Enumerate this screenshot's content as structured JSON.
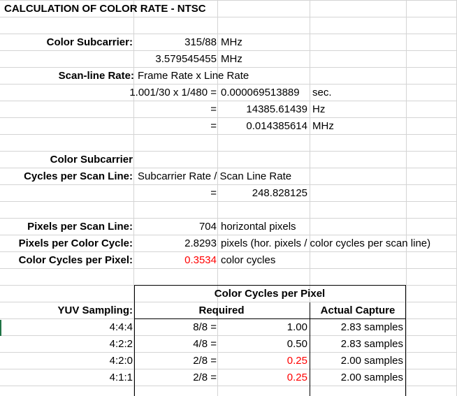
{
  "title": "CALCULATION OF COLOR RATE - NTSC",
  "color_subcarrier": {
    "label": "Color Subcarrier:",
    "fraction": "315/88",
    "fraction_unit": "MHz",
    "decimal": "3.579545455",
    "decimal_unit": "MHz"
  },
  "scan_line_rate": {
    "label": "Scan-line Rate:",
    "formula": "Frame Rate x Line Rate",
    "expr": "1.001/30 x 1/480 =",
    "value_sec": "0.000069513889",
    "unit_sec": "sec.",
    "eq": "=",
    "value_hz": "14385.61439",
    "unit_hz": "Hz",
    "value_mhz": "0.014385614",
    "unit_mhz": "MHz"
  },
  "cycles_per_scan_line": {
    "label_line1": "Color Subcarrier",
    "label_line2": "Cycles per Scan Line:",
    "formula": "Subcarrier Rate / Scan Line Rate",
    "eq": "=",
    "value": "248.828125"
  },
  "pixels_per_scan_line": {
    "label": "Pixels per Scan Line:",
    "value": "704",
    "unit": "horizontal pixels"
  },
  "pixels_per_color_cycle": {
    "label": "Pixels per Color Cycle:",
    "value": "2.8293",
    "unit": "pixels (hor. pixels / color cycles per scan line)"
  },
  "color_cycles_per_pixel": {
    "label": "Color Cycles per Pixel:",
    "value": "0.3534",
    "unit": "color cycles"
  },
  "yuv_table": {
    "group_header": "Color Cycles per Pixel",
    "row_label": "YUV Sampling:",
    "col_required": "Required",
    "col_actual": "Actual Capture",
    "rows": [
      {
        "sampling": "4:4:4",
        "fraction": "8/8 =",
        "value": "1.00",
        "actual": "2.83 samples",
        "highlight": false
      },
      {
        "sampling": "4:2:2",
        "fraction": "4/8 =",
        "value": "0.50",
        "actual": "2.83 samples",
        "highlight": false
      },
      {
        "sampling": "4:2:0",
        "fraction": "2/8 =",
        "value": "0.25",
        "actual": "2.00 samples",
        "highlight": true
      },
      {
        "sampling": "4:1:1",
        "fraction": "2/8 =",
        "value": "0.25",
        "actual": "2.00 samples",
        "highlight": true
      }
    ]
  },
  "colors": {
    "highlight_red": "#ff0000",
    "gridline": "#d4d4d4",
    "selection_green": "#217346"
  }
}
